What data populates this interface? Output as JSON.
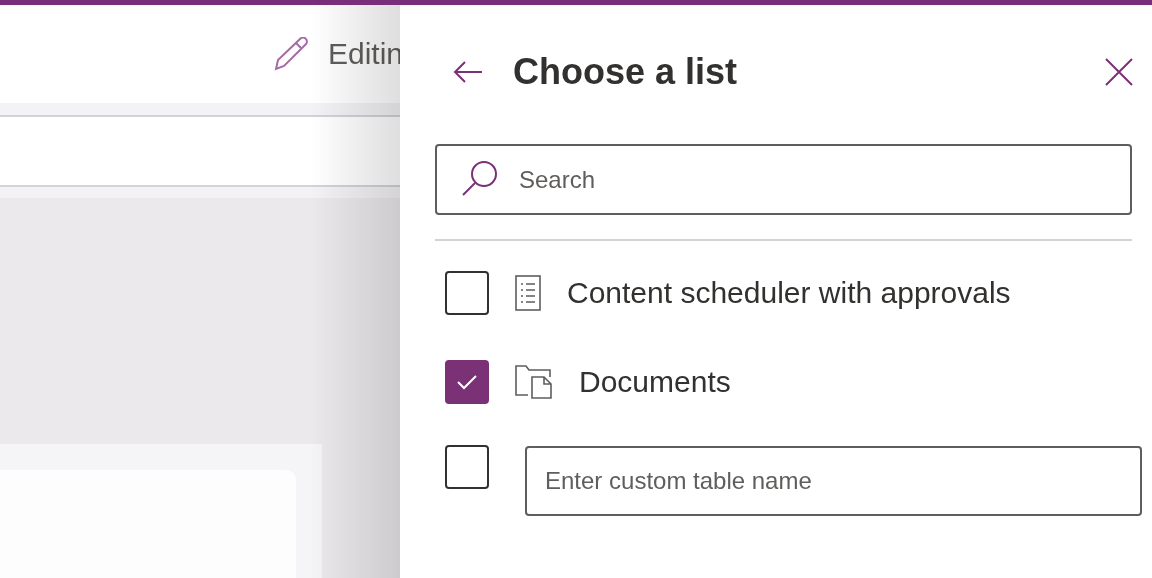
{
  "top_bar": {
    "status": "Editin"
  },
  "panel": {
    "title": "Choose a list",
    "search": {
      "placeholder": "Search"
    },
    "lists": [
      {
        "kind": "list",
        "label": "Content scheduler with approvals",
        "checked": false
      },
      {
        "kind": "library",
        "label": "Documents",
        "checked": true
      },
      {
        "kind": "custom",
        "placeholder": "Enter custom table name",
        "checked": false
      }
    ]
  }
}
